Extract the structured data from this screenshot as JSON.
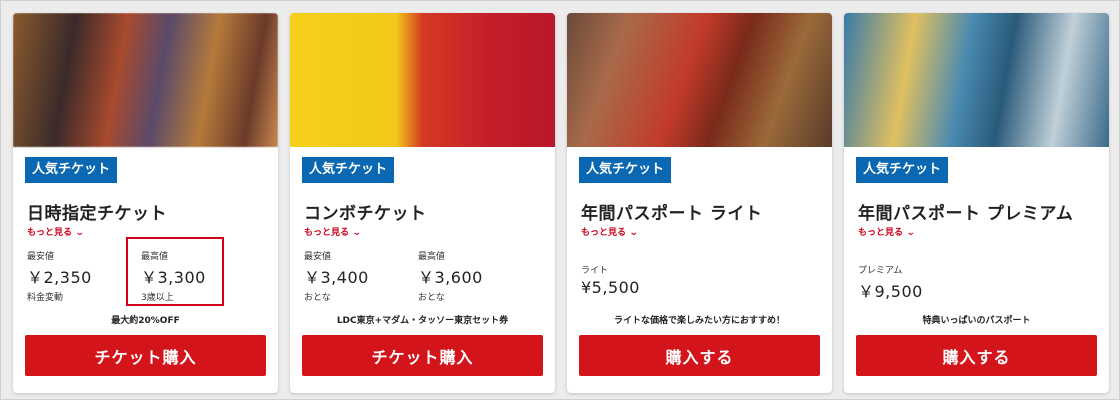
{
  "colors": {
    "badge": "#0a67b2",
    "cta": "#d3151b",
    "accent_red": "#d0021b"
  },
  "cards": [
    {
      "badge": "人気チケット",
      "title": "日時指定チケット",
      "more": "もっと見る",
      "low_label": "最安値",
      "low_price": "￥2,350",
      "low_note": "料金変動",
      "high_label": "最高値",
      "high_price": "￥3,300",
      "high_note": "3歳以上",
      "tagline": "最大約20%OFF",
      "cta": "チケット購入"
    },
    {
      "badge": "人気チケット",
      "title": "コンボチケット",
      "more": "もっと見る",
      "low_label": "最安値",
      "low_price": "￥3,400",
      "low_note": "おとな",
      "high_label": "最高値",
      "high_price": "￥3,600",
      "high_note": "おとな",
      "tagline": "LDC東京+マダム・タッソー東京セット券",
      "cta": "チケット購入"
    },
    {
      "badge": "人気チケット",
      "title": "年間パスポート ライト",
      "more": "もっと見る",
      "price_label": "ライト",
      "price": "¥5,500",
      "tagline": "ライトな価格で楽しみたい方におすすめ！",
      "cta": "購入する"
    },
    {
      "badge": "人気チケット",
      "title": "年間パスポート プレミアム",
      "more": "もっと見る",
      "price_label": "プレミアム",
      "price": "￥9,500",
      "tagline": "特典いっぱいのパスポート",
      "cta": "購入する"
    }
  ]
}
